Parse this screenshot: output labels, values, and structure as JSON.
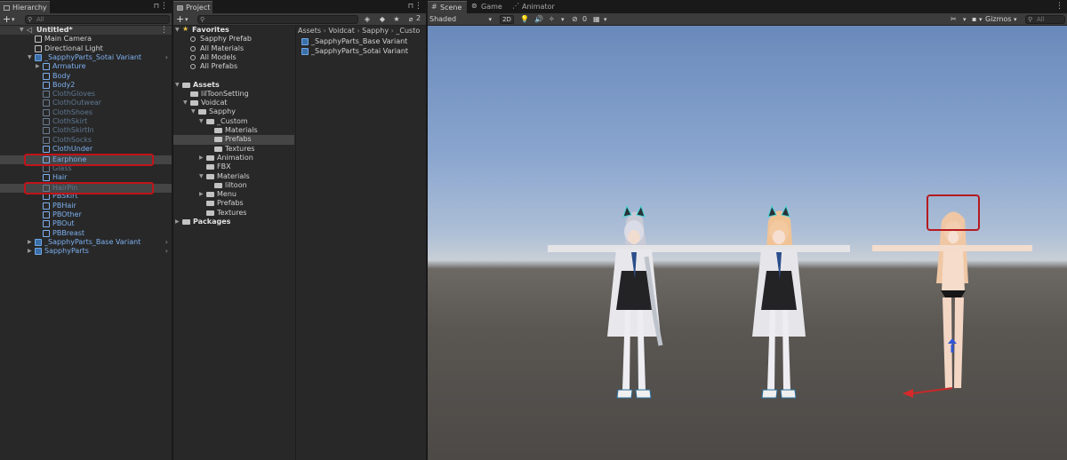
{
  "hierarchy": {
    "tab_title": "Hierarchy",
    "search_placeholder": "All",
    "scene_name": "Untitled*",
    "items": [
      {
        "label": "Main Camera"
      },
      {
        "label": "Directional Light"
      },
      {
        "label": "_SapphyParts_Sotai Variant"
      },
      {
        "label": "Armature"
      },
      {
        "label": "Body"
      },
      {
        "label": "Body2"
      },
      {
        "label": "ClothGloves"
      },
      {
        "label": "ClothOutwear"
      },
      {
        "label": "ClothShoes"
      },
      {
        "label": "ClothSkirt"
      },
      {
        "label": "ClothSkirtIn"
      },
      {
        "label": "ClothSocks"
      },
      {
        "label": "ClothUnder"
      },
      {
        "label": "Earphone"
      },
      {
        "label": "Glass"
      },
      {
        "label": "Hair"
      },
      {
        "label": "HairPin"
      },
      {
        "label": "PBSkirt"
      },
      {
        "label": "PBHair"
      },
      {
        "label": "PBOther"
      },
      {
        "label": "PBOut"
      },
      {
        "label": "PBBreast"
      },
      {
        "label": "_SapphyParts_Base Variant"
      },
      {
        "label": "SapphyParts"
      }
    ]
  },
  "project": {
    "tab_title": "Project",
    "badge_count": "2",
    "favorites_label": "Favorites",
    "favorites": [
      "Sapphy Prefab",
      "All Materials",
      "All Models",
      "All Prefabs"
    ],
    "assets_label": "Assets",
    "tree": [
      "lilToonSetting",
      "Voidcat",
      "Sapphy",
      "_Custom",
      "Materials",
      "Prefabs",
      "Textures",
      "Animation",
      "FBX",
      "Materials",
      "liltoon",
      "Menu",
      "Prefabs",
      "Textures"
    ],
    "packages_label": "Packages",
    "breadcrumb": [
      "Assets",
      "Voidcat",
      "Sapphy",
      "_Custo"
    ],
    "files": [
      "_SapphyParts_Base Variant",
      "_SapphyParts_Sotai Variant"
    ]
  },
  "scene": {
    "tabs": [
      "Scene",
      "Game",
      "Animator"
    ],
    "shading_mode": "Shaded",
    "mode_2d": "2D",
    "hidden_count": "0",
    "gizmos_label": "Gizmos",
    "search_placeholder": "All"
  }
}
